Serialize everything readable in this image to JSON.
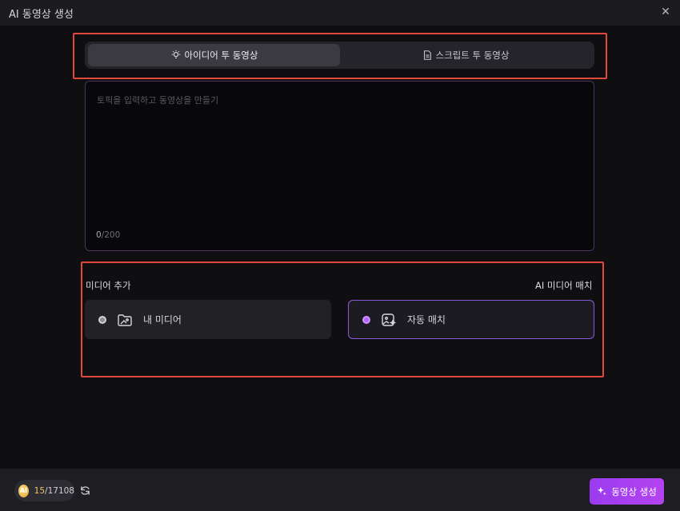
{
  "window": {
    "title": "AI 동영상 생성"
  },
  "tabs": [
    {
      "label": "아이디어 투 동영상",
      "icon": "lightbulb-icon",
      "active": true
    },
    {
      "label": "스크립트 투 동영상",
      "icon": "document-icon",
      "active": false
    }
  ],
  "prompt": {
    "placeholder": "토픽을 입력하고 동영상을 만들기",
    "count_current": "0",
    "count_max": "/200"
  },
  "media": {
    "section_label": "미디어 추가",
    "match_label": "AI 미디어 매치",
    "options": [
      {
        "label": "내 미디어",
        "icon": "folder-image-icon",
        "selected": false
      },
      {
        "label": "자동 매치",
        "icon": "image-sparkle-icon",
        "selected": true
      }
    ]
  },
  "footer": {
    "credits_used": "15",
    "credits_total": "/17108",
    "coin_label": "AI",
    "generate_label": "동영상 생성"
  },
  "colors": {
    "accent": "#a23df0",
    "highlight_border": "#e0483a",
    "selected_radio": "#b566ff"
  }
}
